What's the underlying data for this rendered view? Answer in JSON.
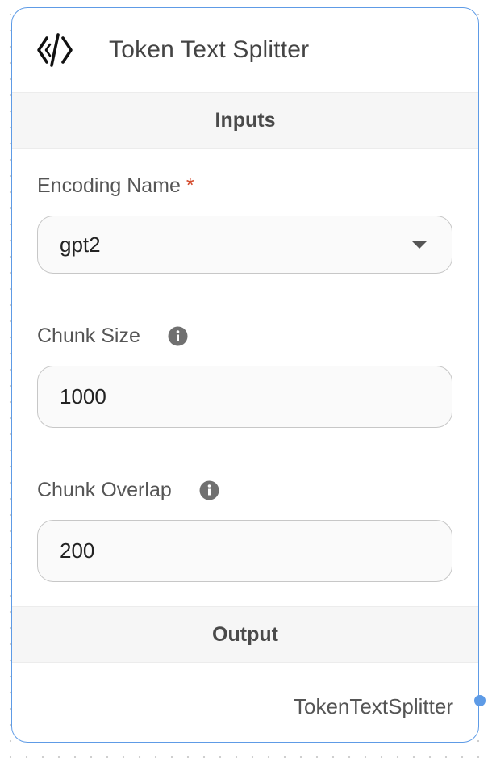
{
  "node": {
    "title": "Token Text Splitter",
    "icon": "code-brackets-icon",
    "accent_color": "#5e9be6"
  },
  "inputs_section": {
    "label": "Inputs",
    "fields": [
      {
        "label": "Encoding Name",
        "required_mark": "*",
        "type": "select",
        "value": "gpt2"
      },
      {
        "label": "Chunk Size",
        "info_icon": "info-icon",
        "type": "number",
        "value": "1000"
      },
      {
        "label": "Chunk Overlap",
        "info_icon": "info-icon",
        "type": "number",
        "value": "200"
      }
    ]
  },
  "output_section": {
    "label": "Output",
    "output_name": "TokenTextSplitter"
  }
}
